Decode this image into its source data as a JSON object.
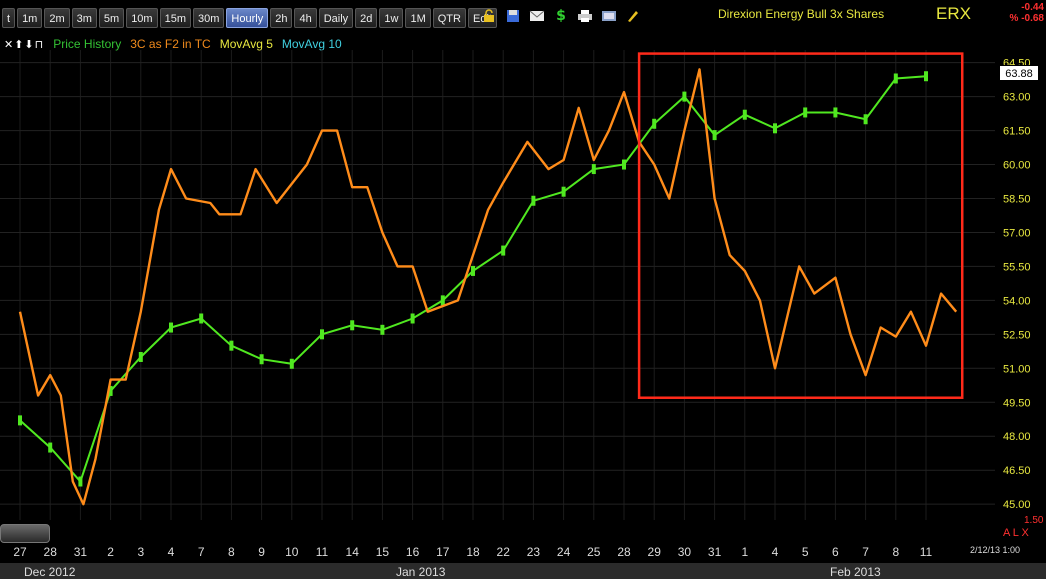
{
  "toolbar": {
    "timeframes": [
      "t",
      "1m",
      "2m",
      "3m",
      "5m",
      "10m",
      "15m",
      "30m",
      "Hourly",
      "2h",
      "4h",
      "Daily",
      "2d",
      "1w",
      "1M",
      "QTR",
      "Edit"
    ],
    "active_timeframe": "Hourly",
    "icons": [
      "lock-icon",
      "save-icon",
      "mail-icon",
      "dollar-icon",
      "print-icon",
      "settings-icon",
      "pencil-icon"
    ]
  },
  "header": {
    "title": "Direxion Energy Bull 3x Shares",
    "symbol": "ERX",
    "change": "-0.44",
    "change_pct": "% -0.68"
  },
  "legend": {
    "icons": "✕⬆⬇⊓",
    "items": [
      {
        "label": "Price History",
        "color": "#34c234"
      },
      {
        "label": "3C as F2 in TC",
        "color": "#f08a1c"
      },
      {
        "label": "MovAvg 5",
        "color": "#e8e840"
      },
      {
        "label": "MovAvg 10",
        "color": "#40d0e0"
      }
    ]
  },
  "colors": {
    "price": "#50e820",
    "indicator": "#ff8c1a",
    "highlight": "#ff2a1a",
    "axis_text": "#dddddd"
  },
  "footer": {
    "date": "2/12/13 1:00",
    "vol": "1.50",
    "alx": "A L X"
  },
  "months": [
    "Dec 2012",
    "Jan 2013",
    "Feb 2013"
  ],
  "chart_data": {
    "type": "line",
    "last_price": "63.88",
    "y_ticks": [
      "64.50",
      "63.00",
      "61.50",
      "60.00",
      "58.50",
      "57.00",
      "55.50",
      "54.00",
      "52.50",
      "51.00",
      "49.50",
      "48.00",
      "46.50",
      "45.00"
    ],
    "ylim": [
      44.3,
      65.5
    ],
    "x_labels": [
      "27",
      "28",
      "31",
      "2",
      "3",
      "4",
      "7",
      "8",
      "9",
      "10",
      "11",
      "14",
      "15",
      "16",
      "17",
      "18",
      "22",
      "23",
      "24",
      "25",
      "28",
      "29",
      "30",
      "31",
      "1",
      "4",
      "5",
      "6",
      "7",
      "8",
      "11"
    ],
    "series": [
      {
        "name": "Price History",
        "points": [
          [
            0,
            48.7
          ],
          [
            1,
            47.5
          ],
          [
            2,
            46.0
          ],
          [
            3,
            50.0
          ],
          [
            4,
            51.5
          ],
          [
            5,
            52.8
          ],
          [
            6,
            53.2
          ],
          [
            7,
            52.0
          ],
          [
            8,
            51.4
          ],
          [
            9,
            51.2
          ],
          [
            10,
            52.5
          ],
          [
            11,
            52.9
          ],
          [
            12,
            52.7
          ],
          [
            13,
            53.2
          ],
          [
            14,
            54.0
          ],
          [
            15,
            55.3
          ],
          [
            16,
            56.2
          ],
          [
            17,
            58.4
          ],
          [
            18,
            58.8
          ],
          [
            19,
            59.8
          ],
          [
            20,
            60.0
          ],
          [
            21,
            61.8
          ],
          [
            22,
            63.0
          ],
          [
            23,
            61.3
          ],
          [
            24,
            62.2
          ],
          [
            25,
            61.6
          ],
          [
            26,
            62.3
          ],
          [
            27,
            62.3
          ],
          [
            28,
            62.0
          ],
          [
            29,
            63.8
          ],
          [
            30,
            63.9
          ]
        ]
      },
      {
        "name": "3C as F2 in TC",
        "points": [
          [
            0,
            53.5
          ],
          [
            0.6,
            49.8
          ],
          [
            1,
            50.7
          ],
          [
            1.35,
            49.8
          ],
          [
            1.75,
            46.0
          ],
          [
            2.1,
            45.0
          ],
          [
            2.5,
            47.0
          ],
          [
            3.0,
            50.5
          ],
          [
            3.5,
            50.5
          ],
          [
            4.0,
            53.5
          ],
          [
            4.6,
            58.0
          ],
          [
            5.0,
            59.8
          ],
          [
            5.5,
            58.5
          ],
          [
            6.3,
            58.3
          ],
          [
            6.6,
            57.8
          ],
          [
            7.3,
            57.8
          ],
          [
            7.8,
            59.8
          ],
          [
            8.5,
            58.3
          ],
          [
            9.5,
            60.0
          ],
          [
            10.0,
            61.5
          ],
          [
            10.5,
            61.5
          ],
          [
            11.0,
            59.0
          ],
          [
            11.5,
            59.0
          ],
          [
            12.0,
            57.0
          ],
          [
            12.5,
            55.5
          ],
          [
            13.0,
            55.5
          ],
          [
            13.5,
            53.5
          ],
          [
            14.5,
            54.0
          ],
          [
            15.0,
            56.0
          ],
          [
            15.5,
            58.0
          ],
          [
            16.0,
            59.2
          ],
          [
            16.8,
            61.0
          ],
          [
            17.5,
            59.8
          ],
          [
            18.0,
            60.2
          ],
          [
            18.5,
            62.5
          ],
          [
            19.0,
            60.2
          ],
          [
            19.5,
            61.5
          ],
          [
            20.0,
            63.2
          ],
          [
            20.5,
            61.0
          ],
          [
            21.0,
            60.0
          ],
          [
            21.5,
            58.5
          ],
          [
            22.0,
            61.5
          ],
          [
            22.5,
            64.2
          ],
          [
            23.0,
            58.5
          ],
          [
            23.5,
            56.0
          ],
          [
            24.0,
            55.3
          ],
          [
            24.5,
            54.0
          ],
          [
            25.0,
            51.0
          ],
          [
            25.8,
            55.5
          ],
          [
            26.3,
            54.3
          ],
          [
            27.0,
            55.0
          ],
          [
            27.5,
            52.5
          ],
          [
            28.0,
            50.7
          ],
          [
            28.5,
            52.8
          ],
          [
            29.0,
            52.4
          ],
          [
            29.5,
            53.5
          ],
          [
            30.0,
            52.0
          ],
          [
            30.5,
            54.3
          ],
          [
            31.0,
            53.5
          ]
        ]
      }
    ],
    "highlight": {
      "x_range": [
        20.5,
        31.2
      ],
      "y_range": [
        49.7,
        64.9
      ]
    }
  }
}
